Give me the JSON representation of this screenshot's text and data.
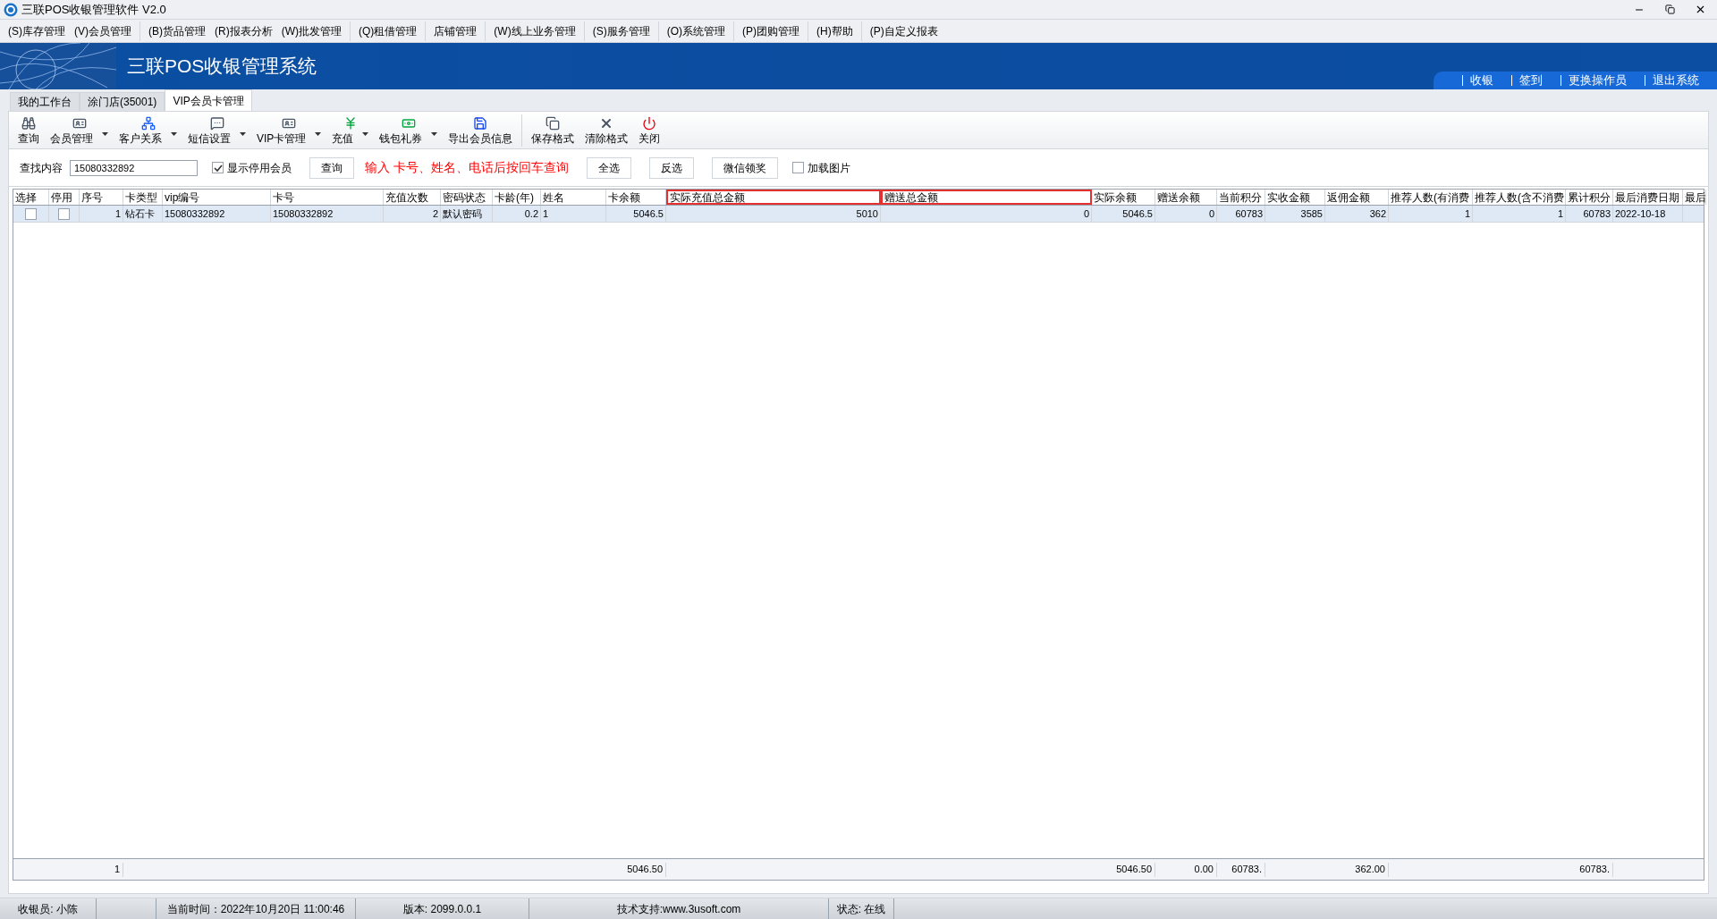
{
  "window": {
    "title": "三联POS收银管理软件 V2.0"
  },
  "menu": [
    {
      "label": "(S)库存管理",
      "group_start": false
    },
    {
      "label": "(V)会员管理",
      "group_start": false
    },
    {
      "label": "(B)货品管理",
      "group_start": true
    },
    {
      "label": "(R)报表分析",
      "group_start": false
    },
    {
      "label": "(W)批发管理",
      "group_start": false
    },
    {
      "label": "(Q)租借管理",
      "group_start": true
    },
    {
      "label": "店铺管理",
      "group_start": true
    },
    {
      "label": "(W)线上业务管理",
      "group_start": true
    },
    {
      "label": "(S)服务管理",
      "group_start": true
    },
    {
      "label": "(O)系统管理",
      "group_start": true
    },
    {
      "label": "(P)团购管理",
      "group_start": true
    },
    {
      "label": "(H)帮助",
      "group_start": true
    },
    {
      "label": "(P)自定义报表",
      "group_start": true
    }
  ],
  "banner": {
    "title": "三联POS收银管理系统",
    "links": [
      "收银",
      "签到",
      "更换操作员",
      "退出系统"
    ]
  },
  "tabs": [
    {
      "label": "我的工作台",
      "selected": false
    },
    {
      "label": "涂门店(35001)",
      "selected": false
    },
    {
      "label": "VIP会员卡管理",
      "selected": true
    }
  ],
  "toolbar": [
    {
      "label": "查询",
      "dropdown": false,
      "group_start": false
    },
    {
      "label": "会员管理",
      "dropdown": true,
      "group_start": false
    },
    {
      "label": "客户关系",
      "dropdown": true,
      "group_start": false
    },
    {
      "label": "短信设置",
      "dropdown": true,
      "group_start": false
    },
    {
      "label": "VIP卡管理",
      "dropdown": true,
      "group_start": false
    },
    {
      "label": "充值",
      "dropdown": true,
      "group_start": false
    },
    {
      "label": "钱包礼券",
      "dropdown": true,
      "group_start": false
    },
    {
      "label": "导出会员信息",
      "dropdown": false,
      "group_start": false
    },
    {
      "label": "保存格式",
      "dropdown": false,
      "group_start": true
    },
    {
      "label": "清除格式",
      "dropdown": false,
      "group_start": false
    },
    {
      "label": "关闭",
      "dropdown": false,
      "group_start": false
    }
  ],
  "search": {
    "label": "查找内容",
    "value": "15080332892",
    "show_disabled": {
      "label": "显示停用会员",
      "checked": true
    },
    "query_button": "查询",
    "hint": "输入 卡号、姓名、电话后按回车查询",
    "buttons": [
      "全选",
      "反选",
      "微信领奖"
    ],
    "load_images": {
      "label": "加载图片",
      "checked": false
    }
  },
  "table": {
    "columns": [
      {
        "label": "选择",
        "kind": "checkbox",
        "highlighted": false
      },
      {
        "label": "停用",
        "kind": "checkbox",
        "highlighted": false
      },
      {
        "label": "序号",
        "kind": "number",
        "highlighted": false,
        "total": "1"
      },
      {
        "label": "卡类型",
        "kind": "text",
        "highlighted": false
      },
      {
        "label": "vip编号",
        "kind": "text",
        "highlighted": false
      },
      {
        "label": "卡号",
        "kind": "text",
        "highlighted": false
      },
      {
        "label": "充值次数",
        "kind": "number",
        "highlighted": false
      },
      {
        "label": "密码状态",
        "kind": "text",
        "highlighted": false
      },
      {
        "label": "卡龄(年)",
        "kind": "number",
        "highlighted": false
      },
      {
        "label": "姓名",
        "kind": "text",
        "highlighted": false
      },
      {
        "label": "卡余额",
        "kind": "number",
        "highlighted": false,
        "total": "5046.50"
      },
      {
        "label": "实际充值总金额",
        "kind": "number",
        "highlighted": true
      },
      {
        "label": "赠送总金额",
        "kind": "number",
        "highlighted": true
      },
      {
        "label": "实际余额",
        "kind": "number",
        "highlighted": false,
        "total": "5046.50"
      },
      {
        "label": "赠送余额",
        "kind": "number",
        "highlighted": false,
        "total": "0.00"
      },
      {
        "label": "当前积分",
        "kind": "number",
        "highlighted": false,
        "total": "60783."
      },
      {
        "label": "实收金额",
        "kind": "number",
        "highlighted": false
      },
      {
        "label": "返佣金额",
        "kind": "number",
        "highlighted": false,
        "total": "362.00"
      },
      {
        "label": "推荐人数(有消费",
        "kind": "number",
        "highlighted": false
      },
      {
        "label": "推荐人数(含不消费",
        "kind": "number",
        "highlighted": false
      },
      {
        "label": "累计积分",
        "kind": "number",
        "highlighted": false,
        "total": "60783."
      },
      {
        "label": "最后消费日期",
        "kind": "text",
        "highlighted": false
      },
      {
        "label": "最后",
        "kind": "text",
        "highlighted": false
      }
    ],
    "rows": [
      {
        "selected": true,
        "cells": [
          {
            "checked": false
          },
          {
            "checked": false
          },
          "1",
          "钻石卡",
          "15080332892",
          "15080332892",
          "2",
          "默认密码",
          "0.2",
          "1",
          "5046.5",
          "5010",
          "0",
          "5046.5",
          "0",
          "60783",
          "3585",
          "362",
          "1",
          "1",
          "60783",
          "2022-10-18"
        ]
      }
    ]
  },
  "status_bar": {
    "cashier": "收银员: 小陈",
    "time": "当前时间：2022年10月20日 11:00:46",
    "version": "版本: 2099.0.0.1",
    "support": "技术支持:www.3usoft.com",
    "status": "状态: 在线"
  }
}
